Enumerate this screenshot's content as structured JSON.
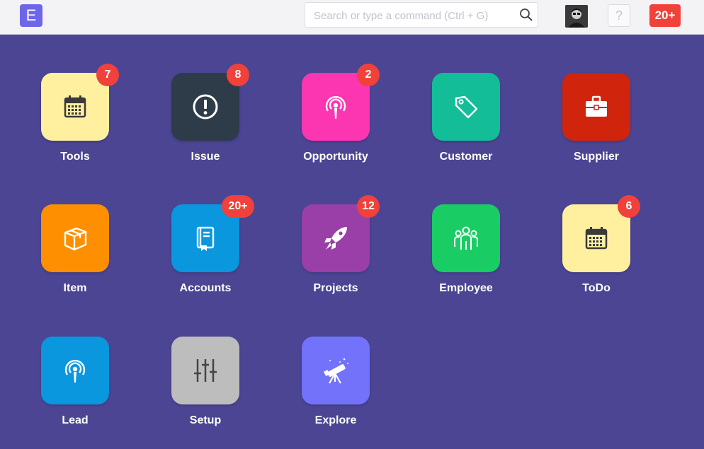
{
  "header": {
    "logo_letter": "E",
    "search_placeholder": "Search or type a command (Ctrl + G)",
    "help_label": "?",
    "notification_count": "20+"
  },
  "modules": [
    {
      "label": "Tools",
      "badge": "7",
      "color": "#fff0a0",
      "icon": "calendar-icon"
    },
    {
      "label": "Issue",
      "badge": "8",
      "color": "#2e3c4a",
      "icon": "alert-circle-icon"
    },
    {
      "label": "Opportunity",
      "badge": "2",
      "color": "#fb36b0",
      "icon": "broadcast-icon"
    },
    {
      "label": "Customer",
      "badge": "",
      "color": "#12bd98",
      "icon": "tag-icon"
    },
    {
      "label": "Supplier",
      "badge": "",
      "color": "#d0240d",
      "icon": "briefcase-icon"
    },
    {
      "label": "Item",
      "badge": "",
      "color": "#fe8f00",
      "icon": "box-icon"
    },
    {
      "label": "Accounts",
      "badge": "20+",
      "color": "#0a97dd",
      "icon": "book-icon"
    },
    {
      "label": "Projects",
      "badge": "12",
      "color": "#9a3fa8",
      "icon": "rocket-icon"
    },
    {
      "label": "Employee",
      "badge": "",
      "color": "#19cc63",
      "icon": "people-icon"
    },
    {
      "label": "ToDo",
      "badge": "6",
      "color": "#fff0a0",
      "icon": "calendar-icon"
    },
    {
      "label": "Lead",
      "badge": "",
      "color": "#0a97dd",
      "icon": "broadcast-icon"
    },
    {
      "label": "Setup",
      "badge": "",
      "color": "#bdbdbd",
      "icon": "sliders-icon"
    },
    {
      "label": "Explore",
      "badge": "",
      "color": "#7272fb",
      "icon": "telescope-icon"
    }
  ]
}
